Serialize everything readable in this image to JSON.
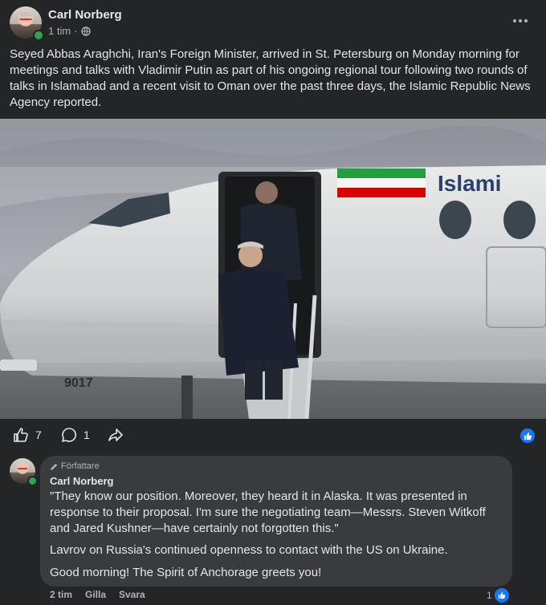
{
  "post": {
    "author": "Carl Norberg",
    "time": "1 tim",
    "separator": "·",
    "text": "Seyed Abbas Araghchi, Iran's Foreign Minister, arrived in St. Petersburg on Monday morning for meetings and talks with Vladimir Putin as part of his ongoing regional tour following two rounds of talks in Islamabad and a recent visit to Oman over the past three days, the Islamic Republic News Agency reported.",
    "photo": {
      "aircraft_text": "Islami",
      "tail_number": "9017"
    }
  },
  "reactions": {
    "like_count": "7",
    "comment_count": "1",
    "accent": "#1877f2"
  },
  "comment": {
    "badge": "Författare",
    "author": "Carl Norberg",
    "paragraphs": [
      "\"They know our position. Moreover, they heard it in Alaska. It was presented in response to their proposal. I'm sure the negotiating team—Messrs. Steven Witkoff and Jared Kushner—have certainly not forgotten this.\"",
      "Lavrov on Russia's continued openness to contact with the US on Ukraine.",
      "Good morning! The Spirit of Anchorage greets you!"
    ],
    "time": "2 tim",
    "like_label": "Gilla",
    "reply_label": "Svara",
    "like_count": "1"
  }
}
